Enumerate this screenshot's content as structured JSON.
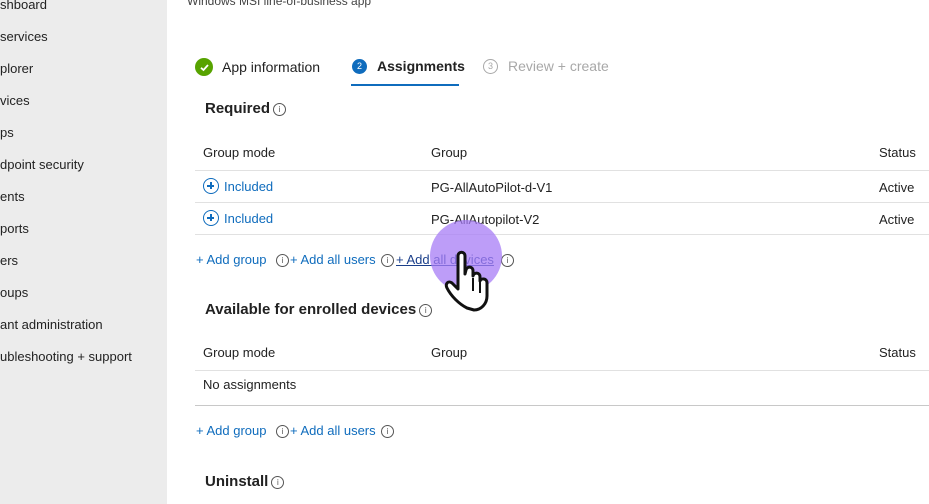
{
  "sidebar": {
    "items": [
      {
        "label": "shboard"
      },
      {
        "label": "services"
      },
      {
        "label": "plorer"
      },
      {
        "label": "vices"
      },
      {
        "label": "ps"
      },
      {
        "label": "dpoint security"
      },
      {
        "label": "ents"
      },
      {
        "label": "ports"
      },
      {
        "label": "ers"
      },
      {
        "label": "oups"
      },
      {
        "label": "ant administration"
      },
      {
        "label": "ubleshooting + support"
      }
    ]
  },
  "header": {
    "subtitle": "Windows MSI line-of-business app"
  },
  "wizard": {
    "steps": [
      {
        "label": "App information",
        "state": "complete"
      },
      {
        "label": "Assignments",
        "number": "2",
        "state": "active"
      },
      {
        "label": "Review + create",
        "number": "3",
        "state": "pending"
      }
    ]
  },
  "required": {
    "title": "Required",
    "columns": {
      "group_mode": "Group mode",
      "group": "Group",
      "status": "Status"
    },
    "rows": [
      {
        "mode": "Included",
        "group": "PG-AllAutoPilot-d-V1",
        "status": "Active"
      },
      {
        "mode": "Included",
        "group": "PG-AllAutopilot-V2",
        "status": "Active"
      }
    ],
    "actions": {
      "add_group": "+ Add group",
      "add_all_users": "+ Add all users",
      "add_all_devices": "+ Add all devices"
    }
  },
  "available": {
    "title": "Available for enrolled devices",
    "columns": {
      "group_mode": "Group mode",
      "group": "Group",
      "status": "Status"
    },
    "empty_text": "No assignments",
    "actions": {
      "add_group": "+ Add group",
      "add_all_users": "+ Add all users"
    }
  },
  "uninstall": {
    "title": "Uninstall"
  },
  "info_glyph": "i",
  "colors": {
    "accent": "#0f6cbd",
    "success": "#57a300",
    "sidebar_bg": "#ececec",
    "cursor_highlight": "#a77cf5"
  }
}
